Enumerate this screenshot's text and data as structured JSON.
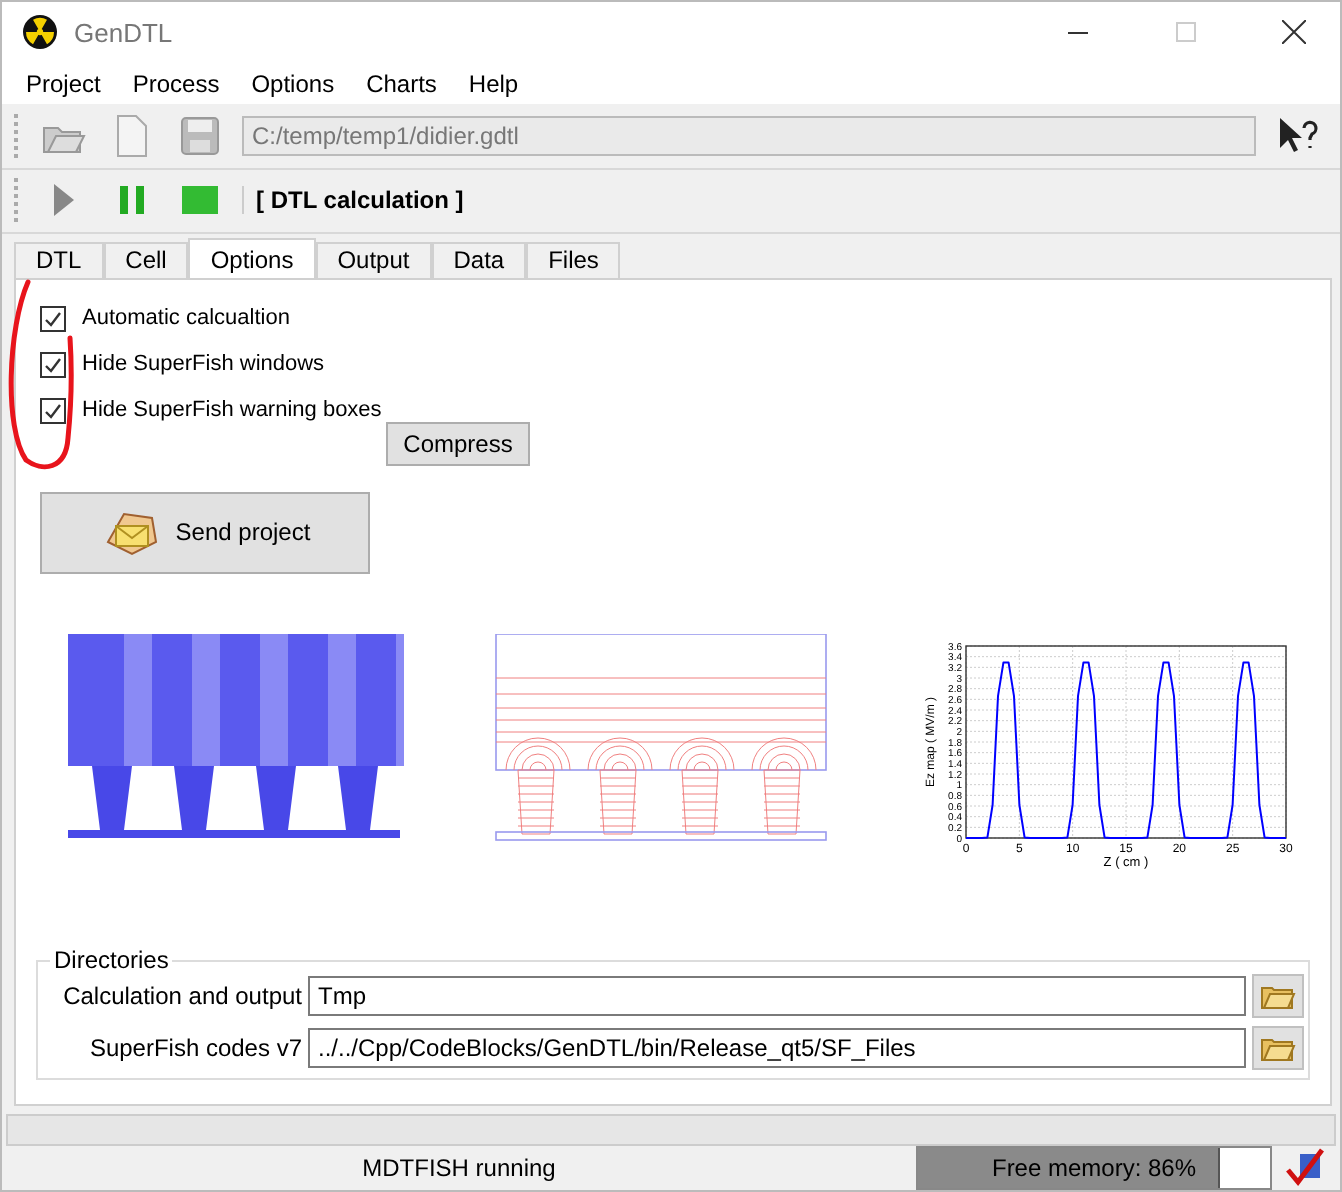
{
  "window": {
    "title": "GenDTL"
  },
  "menu": [
    "Project",
    "Process",
    "Options",
    "Charts",
    "Help"
  ],
  "toolbar": {
    "path": "C:/temp/temp1/didier.gdtl"
  },
  "process_bar": {
    "label": "[ DTL calculation ]"
  },
  "tabs": [
    {
      "label": "DTL",
      "selected": false
    },
    {
      "label": "Cell",
      "selected": false
    },
    {
      "label": "Options",
      "selected": true
    },
    {
      "label": "Output",
      "selected": false
    },
    {
      "label": "Data",
      "selected": false
    },
    {
      "label": "Files",
      "selected": false
    }
  ],
  "options": [
    {
      "label": "Automatic calcualtion",
      "checked": true
    },
    {
      "label": "Hide SuperFish windows",
      "checked": true
    },
    {
      "label": "Hide SuperFish warning boxes",
      "checked": true
    }
  ],
  "compress_button": "Compress",
  "send_button": "Send project",
  "field_chart": {
    "chart_data": {
      "type": "line",
      "xlabel": "Z ( cm )",
      "ylabel": "Ez map ( MV/m )",
      "xlim": [
        0,
        30
      ],
      "ylim": [
        0,
        3.6
      ],
      "xticks": [
        0,
        5,
        10,
        15,
        20,
        25,
        30
      ],
      "yticks": [
        0,
        0.2,
        0.4,
        0.6,
        0.8,
        1,
        1.2,
        1.4,
        1.6,
        1.8,
        2,
        2.2,
        2.4,
        2.6,
        2.8,
        3,
        3.2,
        3.4,
        3.6
      ],
      "x": [
        0,
        0.5,
        1,
        1.5,
        2,
        2.5,
        3,
        3.5,
        4,
        4.5,
        5,
        5.5,
        6,
        6.5,
        7,
        7.5,
        8,
        8.5,
        9,
        9.5,
        10,
        10.5,
        11,
        11.5,
        12,
        12.5,
        13,
        13.5,
        14,
        14.5,
        15,
        15.5,
        16,
        16.5,
        17,
        17.5,
        18,
        18.5,
        19,
        19.5,
        20,
        20.5,
        21,
        21.5,
        22,
        22.5,
        23,
        23.5,
        24,
        24.5,
        25,
        25.5,
        26,
        26.5,
        27,
        27.5,
        28,
        28.5,
        29,
        29.5,
        30
      ],
      "grid": true,
      "series": [
        {
          "color": "#0000ff",
          "values": [
            0,
            0,
            0,
            0,
            0.01,
            0.62,
            2.66,
            3.29,
            3.29,
            2.66,
            0.62,
            0.01,
            0,
            0,
            0,
            0,
            0,
            0,
            0,
            0.01,
            0.62,
            2.66,
            3.29,
            3.29,
            2.66,
            0.62,
            0.01,
            0,
            0,
            0,
            0,
            0,
            0,
            0,
            0.01,
            0.62,
            2.66,
            3.29,
            3.29,
            2.66,
            0.62,
            0.01,
            0,
            0,
            0,
            0,
            0,
            0,
            0,
            0.01,
            0.62,
            2.66,
            3.29,
            3.29,
            2.66,
            0.62,
            0.01,
            0,
            0,
            0,
            0
          ]
        }
      ]
    }
  },
  "directories": {
    "title": "Directories",
    "rows": [
      {
        "label": "Calculation and output",
        "value": "Tmp"
      },
      {
        "label": "SuperFish codes v7",
        "value": "../../Cpp/CodeBlocks/GenDTL/bin/Release_qt5/SF_Files"
      }
    ]
  },
  "status_bar": {
    "message": "MDTFISH running",
    "memory": {
      "label": "Free memory: 86%",
      "level": 0.86
    }
  }
}
